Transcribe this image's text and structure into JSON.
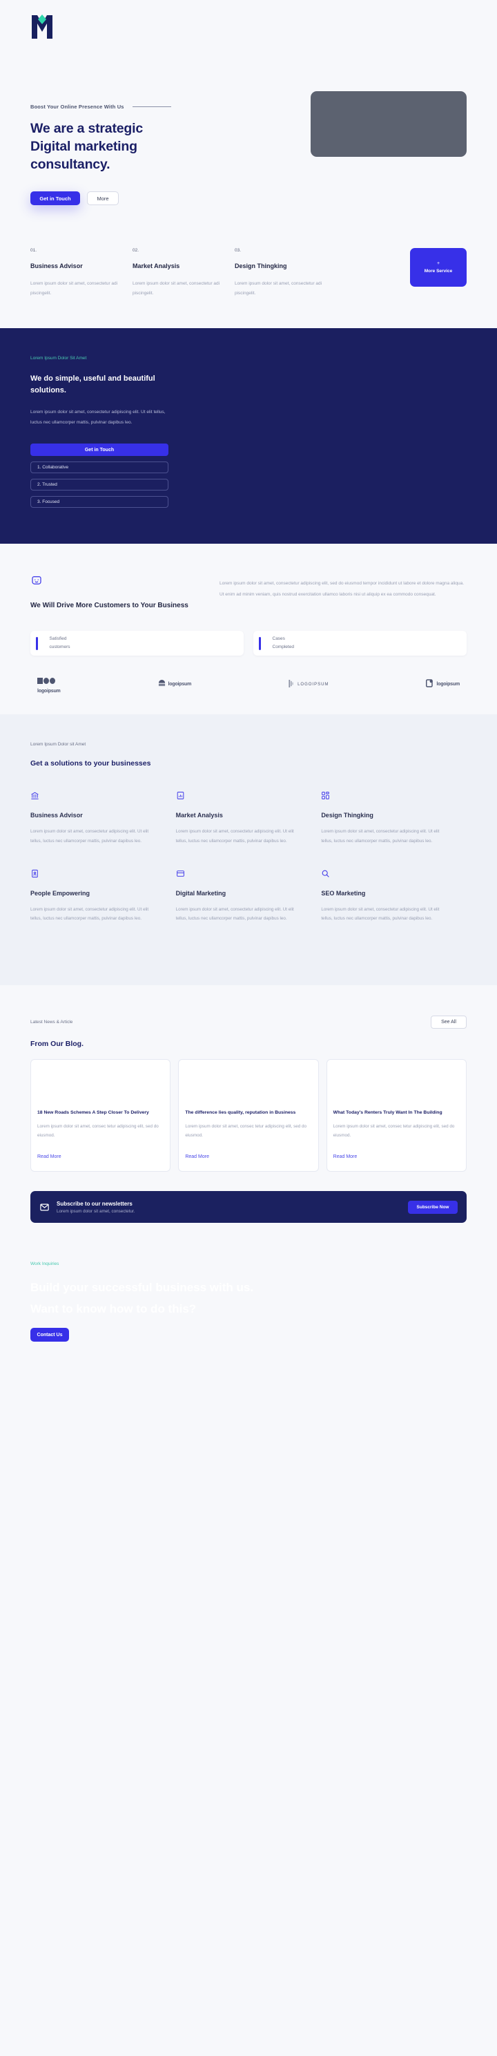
{
  "brand": {
    "logo_name": "m-logo",
    "primary": "#3730e8",
    "dark": "#1b1f60",
    "accent": "#49c9b0"
  },
  "hero": {
    "eyebrow": "Boost Your Online Presence With Us",
    "heading_line1": "We are a strategic",
    "heading_line2": "Digital marketing",
    "heading_line3": "consultancy.",
    "primary_button": "Get in Touch",
    "secondary_button": "More",
    "image_alt": "man-working-at-desk-photo"
  },
  "services": {
    "items": [
      {
        "num": "01.",
        "title": "Business Advisor",
        "desc": "Lorem ipsum dolor sit amet, consectetur adi piscingelit."
      },
      {
        "num": "02.",
        "title": "Market Analysis",
        "desc": "Lorem ipsum dolor sit amet, consectetur adi piscingelit."
      },
      {
        "num": "03.",
        "title": "Design Thingking",
        "desc": "Lorem ipsum dolor sit amet, consectetur adi piscingelit."
      }
    ],
    "more_card": {
      "plus": "+",
      "label": "More Service"
    }
  },
  "solutions_dark": {
    "eyebrow": "Lorem Ipsum Dolor Sit Amet",
    "heading": "We do simple, useful and beautiful solutions.",
    "body": "Lorem ipsum dolor sit amet, consectetur adipiscing elit. Ut elit tellus, luctus nec ullamcorper mattis, pulvinar dapibus leo.",
    "button": "Get in Touch",
    "pills": [
      "1. Collaborative",
      "2. Trusted",
      "3. Focused"
    ],
    "image_main_alt": "hand-pointing-at-laptop-photo",
    "image_small_1_alt": "team-meeting-photo",
    "image_small_2_alt": "desk-planning-photo"
  },
  "drive": {
    "icon": "smiley-icon",
    "heading": "We Will Drive More Customers to Your Business",
    "body": "Lorem ipsum dolor sit amet, consectetur adipiscing elit, sed do eiusmod tempor incididunt ut labore et dolore magna aliqua. Ut enim ad minim veniam, quis nostrud exercitation ullamco laboris nisi ut aliquip ex ea commodo consequat.",
    "stats": [
      {
        "value": "",
        "line1": "Satisfied",
        "line2": "customers"
      },
      {
        "value": "",
        "line1": "Cases",
        "line2": "Completed"
      }
    ],
    "logos": [
      {
        "name": "logoipsum",
        "suffix": "°",
        "style": "blocks"
      },
      {
        "name": "logoipsum",
        "suffix": "",
        "style": "wave"
      },
      {
        "name": "LOGOIPSUM",
        "suffix": "",
        "style": "bars"
      },
      {
        "name": "logoipsum",
        "suffix": "",
        "style": "flag"
      }
    ]
  },
  "solutions": {
    "eyebrow": "Lorem Ipsum Dolor sit Amet",
    "heading": "Get a solutions to your businesses",
    "body_common": "Lorem ipsum dolor sit amet, consectetur adipiscing elit. Ut elit tellus, luctus nec ullamcorper mattis, pulvinar dapibus leo.",
    "items": [
      {
        "icon": "bank-icon",
        "title": "Business Advisor"
      },
      {
        "icon": "chart-icon",
        "title": "Market Analysis"
      },
      {
        "icon": "grid-icon",
        "title": "Design Thingking"
      },
      {
        "icon": "id-card-icon",
        "title": "People Empowering"
      },
      {
        "icon": "browser-icon",
        "title": "Digital Marketing"
      },
      {
        "icon": "search-icon",
        "title": "SEO Marketing"
      }
    ]
  },
  "blog": {
    "eyebrow": "Latest News & Article",
    "see_all": "See All",
    "heading": "From Our Blog.",
    "posts": [
      {
        "title": "18 New Roads Schemes A Step Closer To Delivery",
        "excerpt": "Lorem ipsum dolor sit amet, consec tetur adipiscing elit, sed do eiusmod.",
        "link": "Read More",
        "image_alt": "documents-and-charts-photo"
      },
      {
        "title": "The difference lies quality, reputation in Business",
        "excerpt": "Lorem ipsum dolor sit amet, consec tetur adipiscing elit, sed do eiusmod.",
        "link": "Read More",
        "image_alt": "overhead-desk-blueprint-photo"
      },
      {
        "title": "What Today's Renters Truly Want In The Building",
        "excerpt": "Lorem ipsum dolor sit amet, consec tetur adipiscing elit, sed do eiusmod.",
        "link": "Read More",
        "image_alt": "architecture-plans-photo"
      }
    ]
  },
  "newsletter": {
    "icon": "mail-icon",
    "title": "Subscribe to our newsletters",
    "subtitle": "Lorem ipsum dolor sit amet, consectetur.",
    "button": "Subscribe Now"
  },
  "cta": {
    "eyebrow": "Work Inquiries",
    "heading_line1": "Build your successful business with us.",
    "heading_line2": "Want to know how to do this?",
    "button": "Contact Us"
  }
}
